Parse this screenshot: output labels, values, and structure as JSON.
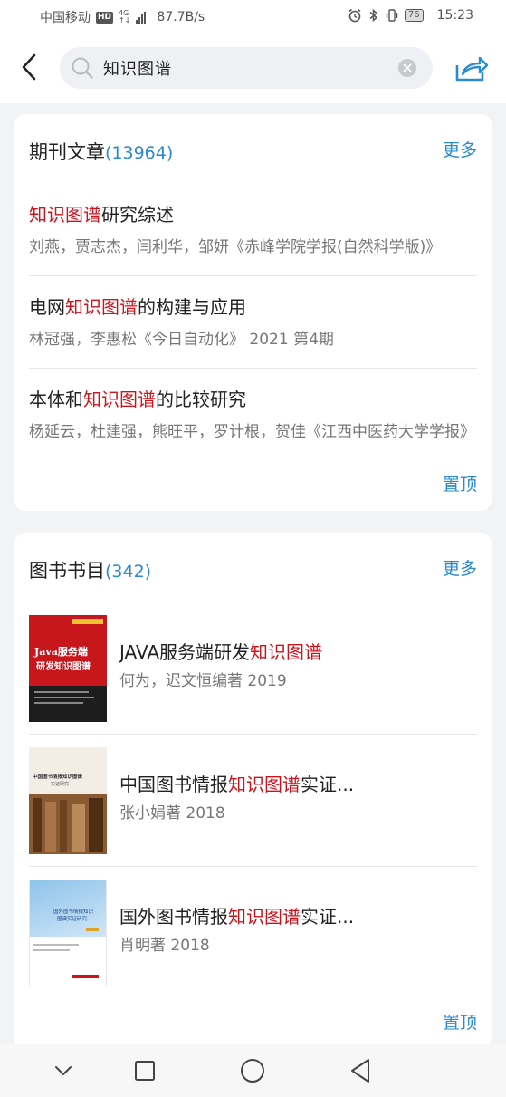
{
  "status_bar": {
    "carrier": "中国移动",
    "hd": "HD",
    "net_top": "4G",
    "net_bottom": "↑↓",
    "speed": "87.7B/s",
    "battery": "76",
    "time": "15:23"
  },
  "header": {
    "search_value": "知识图谱"
  },
  "journals": {
    "title": "期刊文章",
    "count": "(13964)",
    "more_label": "更多",
    "pin_label": "置顶",
    "items": [
      {
        "title_pre": "",
        "title_hl": "知识图谱",
        "title_post": "研究综述",
        "meta": "刘燕，贾志杰，闫利华，邹妍《赤峰学院学报(自然科学版)》"
      },
      {
        "title_pre": "电网",
        "title_hl": "知识图谱",
        "title_post": "的构建与应用",
        "meta": "林冠强，李惠松《今日自动化》 2021 第4期"
      },
      {
        "title_pre": "本体和",
        "title_hl": "知识图谱",
        "title_post": "的比较研究",
        "meta": "杨延云，杜建强，熊旺平，罗计根，贺佳《江西中医药大学学报》"
      }
    ]
  },
  "books": {
    "title": "图书书目",
    "count": "(342)",
    "more_label": "更多",
    "pin_label": "置顶",
    "items": [
      {
        "title_pre": "JAVA服务端研发",
        "title_hl": "知识图谱",
        "title_post": "",
        "meta": "何为，迟文恒编著   2019",
        "cover_text_1": "Java服务端",
        "cover_text_2": "研发知识图谱"
      },
      {
        "title_pre": "中国图书情报",
        "title_hl": "知识图谱",
        "title_post": "实证...",
        "meta": "张小娟著   2018",
        "cover_text_1": "中国图书情报知识图谱",
        "cover_text_2": "实证研究"
      },
      {
        "title_pre": "国外图书情报",
        "title_hl": "知识图谱",
        "title_post": "实证...",
        "meta": "肖明著   2018",
        "cover_text_1": "国外图书情报知识",
        "cover_text_2": "图谱实证研究"
      }
    ]
  },
  "colors": {
    "accent": "#2a8ad4",
    "highlight": "#d0121b"
  }
}
